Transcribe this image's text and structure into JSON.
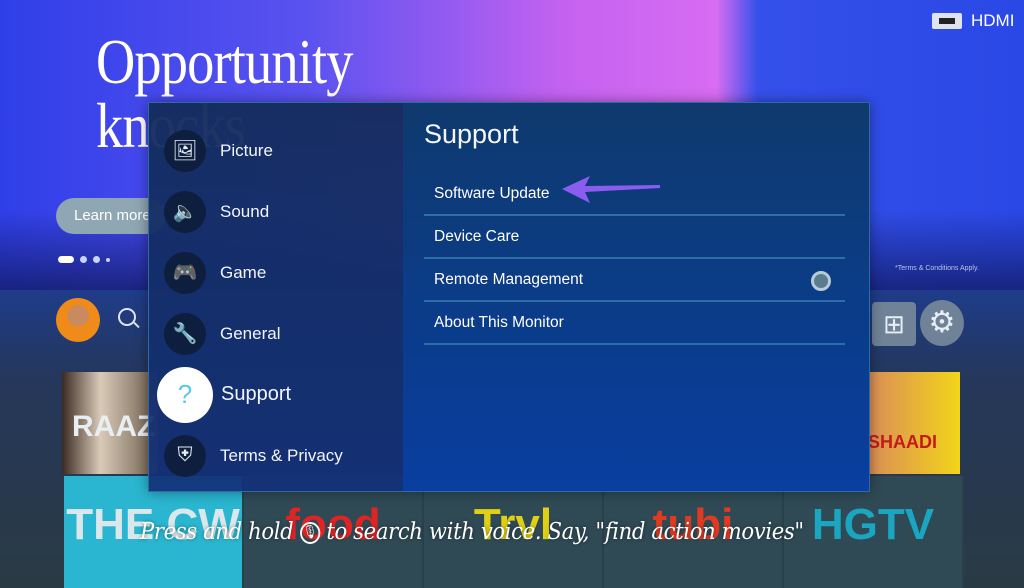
{
  "background": {
    "hero_title": [
      "Opportunity",
      "knocks"
    ],
    "learn_more": "Learn more",
    "input_source": "HDMI",
    "terms_note": "*Terms & Conditions Apply.",
    "thumbnails": [
      "RAAZ",
      "SHAADI"
    ],
    "channels": [
      "THE CW",
      "food",
      "Trvl",
      "tubi",
      "HGTV"
    ],
    "caption_before": "Press and hold ",
    "caption_after": " to search with voice. Say, \"find action movies\""
  },
  "menu": {
    "categories": [
      {
        "label": "Picture",
        "icon": "picture-icon",
        "symbol": "🖼"
      },
      {
        "label": "Sound",
        "icon": "speaker-icon",
        "symbol": "🔈"
      },
      {
        "label": "Game",
        "icon": "gamepad-icon",
        "symbol": "🎮"
      },
      {
        "label": "General",
        "icon": "wrench-icon",
        "symbol": "🔧"
      },
      {
        "label": "Support",
        "icon": "support-cloud-icon",
        "symbol": "?",
        "selected": true
      },
      {
        "label": "Terms & Privacy",
        "icon": "shield-icon",
        "symbol": "⛨"
      }
    ],
    "panel_title": "Support",
    "items": [
      {
        "label": "Software Update"
      },
      {
        "label": "Device Care"
      },
      {
        "label": "Remote Management",
        "toggle": "off"
      },
      {
        "label": "About This Monitor"
      }
    ]
  },
  "colors": {
    "annotation_arrow": "#8a5cf0",
    "selected_icon_bg": "#ffffff"
  }
}
